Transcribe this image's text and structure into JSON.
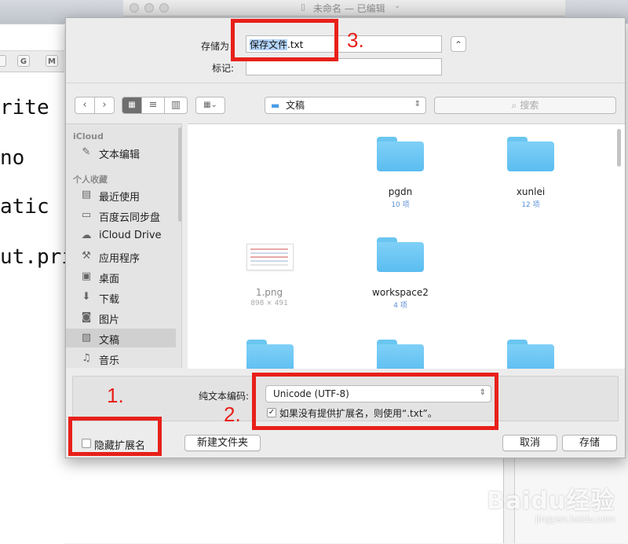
{
  "background_window": {
    "title": "未命名 — 已编辑",
    "toolbar_icons": [
      "G",
      "M"
    ],
    "code_lines": [
      "rite",
      "no",
      "atic",
      "ut.pri"
    ]
  },
  "dialog": {
    "save_as_label": "存储为",
    "filename_value": "保存文件.txt",
    "filename_selected_part": "保存文件",
    "filename_ext": ".txt",
    "tags_label": "标记:",
    "tags_value": "",
    "expand_glyph": "⌃",
    "location": "文稿",
    "search_placeholder": "搜索",
    "sidebar": {
      "icloud_header": "iCloud",
      "icloud_items": [
        {
          "label": "文本编辑",
          "icon": "textedit-icon"
        }
      ],
      "favorites_header": "个人收藏",
      "favorite_items": [
        {
          "label": "最近使用",
          "icon": "recents-icon"
        },
        {
          "label": "百度云同步盘",
          "icon": "folder-icon"
        },
        {
          "label": "iCloud Drive",
          "icon": "cloud-icon"
        },
        {
          "label": "应用程序",
          "icon": "applications-icon"
        },
        {
          "label": "桌面",
          "icon": "desktop-icon"
        },
        {
          "label": "下载",
          "icon": "download-icon"
        },
        {
          "label": "图片",
          "icon": "camera-icon"
        },
        {
          "label": "文稿",
          "icon": "documents-icon",
          "active": true
        },
        {
          "label": "音乐",
          "icon": "music-icon"
        }
      ]
    },
    "files": [
      {
        "name": "pgdn",
        "meta": "10 项",
        "kind": "folder"
      },
      {
        "name": "xunlei",
        "meta": "12 项",
        "kind": "folder"
      },
      {
        "name": "1.png",
        "meta": "898 × 491",
        "kind": "image"
      },
      {
        "name": "workspace2",
        "meta": "4 项",
        "kind": "folder"
      }
    ],
    "encoding_label": "纯文本编码:",
    "encoding_value": "Unicode (UTF-8)",
    "append_ext_label": "如果没有提供扩展名，则使用“.txt”。",
    "append_ext_checked": true,
    "hide_ext_label": "隐藏扩展名",
    "hide_ext_checked": false,
    "new_folder_button": "新建文件夹",
    "cancel_button": "取消",
    "save_button": "存储"
  },
  "annotations": {
    "label_1": "1.",
    "label_2": "2.",
    "label_3": "3.",
    "color": "#e8201a"
  },
  "watermark": {
    "brand": "Baidu经验",
    "url": "jingyan.baidu.com"
  }
}
